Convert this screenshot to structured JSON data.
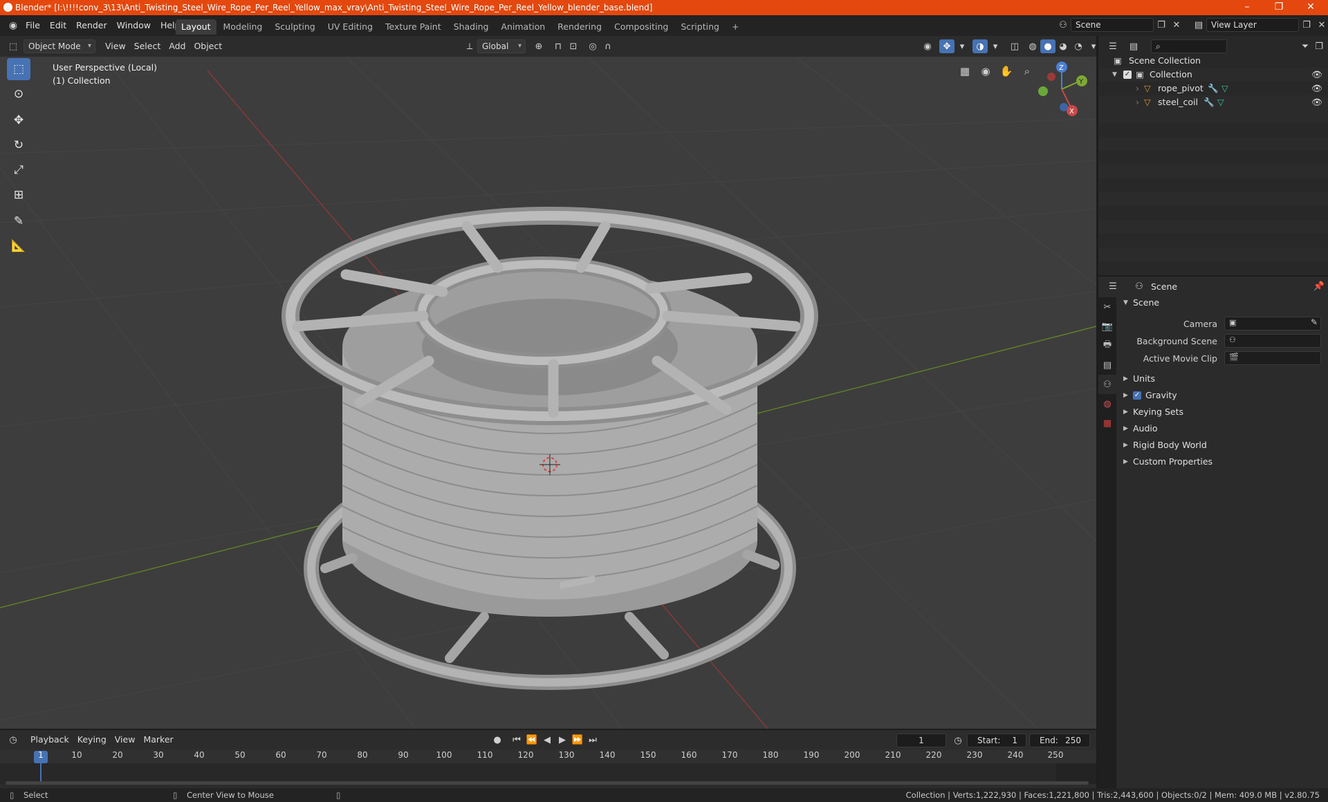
{
  "window": {
    "title": "Blender* [I:\\!!!!conv_3\\13\\Anti_Twisting_Steel_Wire_Rope_Per_Reel_Yellow_max_vray\\Anti_Twisting_Steel_Wire_Rope_Per_Reel_Yellow_blender_base.blend]",
    "minimize": "–",
    "restore": "❐",
    "close": "✕"
  },
  "menu": [
    "File",
    "Edit",
    "Render",
    "Window",
    "Help"
  ],
  "workspaces": [
    "Layout",
    "Modeling",
    "Sculpting",
    "UV Editing",
    "Texture Paint",
    "Shading",
    "Animation",
    "Rendering",
    "Compositing",
    "Scripting"
  ],
  "workspace_add": "+",
  "scene_field": "Scene",
  "view_layer_field": "View Layer",
  "viewport_header": {
    "mode": "Object Mode",
    "menus": [
      "View",
      "Select",
      "Add",
      "Object"
    ],
    "transform_orientation": "Global"
  },
  "viewport": {
    "perspective_label": "User Perspective (Local)",
    "collection_label": "(1) Collection",
    "gizmo": {
      "z": "Z",
      "y": "Y",
      "x": "X"
    }
  },
  "outliner": {
    "root": "Scene Collection",
    "collection": "Collection",
    "objects": [
      "rope_pivot",
      "steel_coil"
    ]
  },
  "properties": {
    "context": "Scene",
    "section": "Scene",
    "fields": [
      {
        "label": "Camera"
      },
      {
        "label": "Background Scene"
      },
      {
        "label": "Active Movie Clip"
      }
    ],
    "panels": [
      "Units",
      "Gravity",
      "Keying Sets",
      "Audio",
      "Rigid Body World",
      "Custom Properties"
    ]
  },
  "timeline": {
    "menus": [
      "Playback",
      "Keying",
      "View",
      "Marker"
    ],
    "current_frame": "1",
    "start_label": "Start:",
    "start": "1",
    "end_label": "End:",
    "end": "250",
    "ticks": [
      "1",
      "10",
      "20",
      "30",
      "40",
      "50",
      "60",
      "70",
      "80",
      "90",
      "100",
      "110",
      "120",
      "130",
      "140",
      "150",
      "160",
      "170",
      "180",
      "190",
      "200",
      "210",
      "220",
      "230",
      "240",
      "250"
    ]
  },
  "statusbar": {
    "left_action": "Select",
    "middle_action": "Center View to Mouse",
    "stats": "Collection | Verts:1,222,930 | Faces:1,221,800 | Tris:2,443,600 | Objects:0/2 | Mem: 409.0 MB | v2.80.75"
  },
  "colors": {
    "titlebar": "#e4480e",
    "accent": "#4772b3",
    "viewport_bg": "#3d3d3d",
    "x_axis": "#c84848",
    "y_axis": "#7ea832",
    "z_axis": "#4b7fd6"
  }
}
